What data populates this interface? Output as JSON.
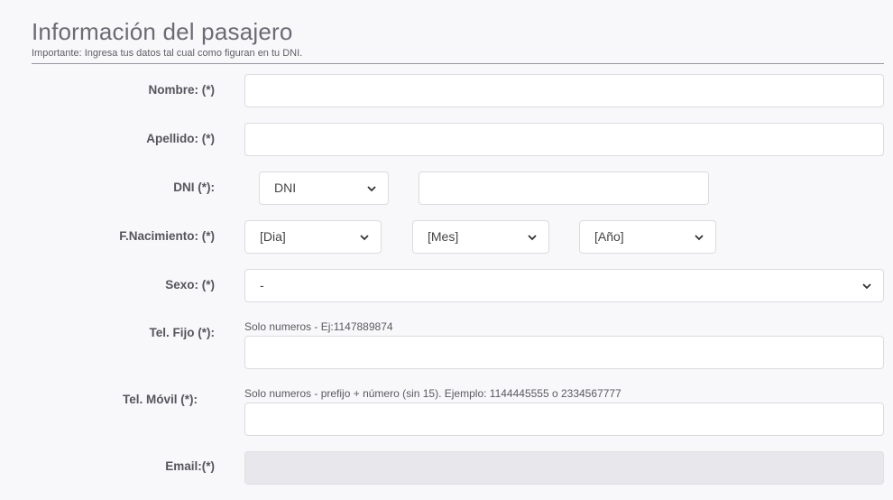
{
  "header": {
    "title": "Información del pasajero",
    "subtitle": "Importante: Ingresa tus datos tal cual como figuran en tu DNI."
  },
  "form": {
    "nombre": {
      "label": "Nombre: (*)",
      "value": ""
    },
    "apellido": {
      "label": "Apellido: (*)",
      "value": ""
    },
    "dni": {
      "label": "DNI (*):",
      "type_selected": "DNI",
      "number_value": ""
    },
    "nacimiento": {
      "label": "F.Nacimiento: (*)",
      "day_selected": "[Dia]",
      "month_selected": "[Mes]",
      "year_selected": "[Año]"
    },
    "sexo": {
      "label": "Sexo: (*)",
      "selected": "-"
    },
    "tel_fijo": {
      "label": "Tel. Fijo (*):",
      "hint": "Solo numeros - Ej:1147889874",
      "value": ""
    },
    "tel_movil": {
      "label": "Tel. Móvil (*):",
      "hint": "Solo numeros - prefijo + número (sin 15). Ejemplo: 1144445555 o 2334567777",
      "value": ""
    },
    "email": {
      "label": "Email:(*)",
      "value": ""
    }
  },
  "icons": {
    "select_arrow": "chevron-down-icon"
  }
}
